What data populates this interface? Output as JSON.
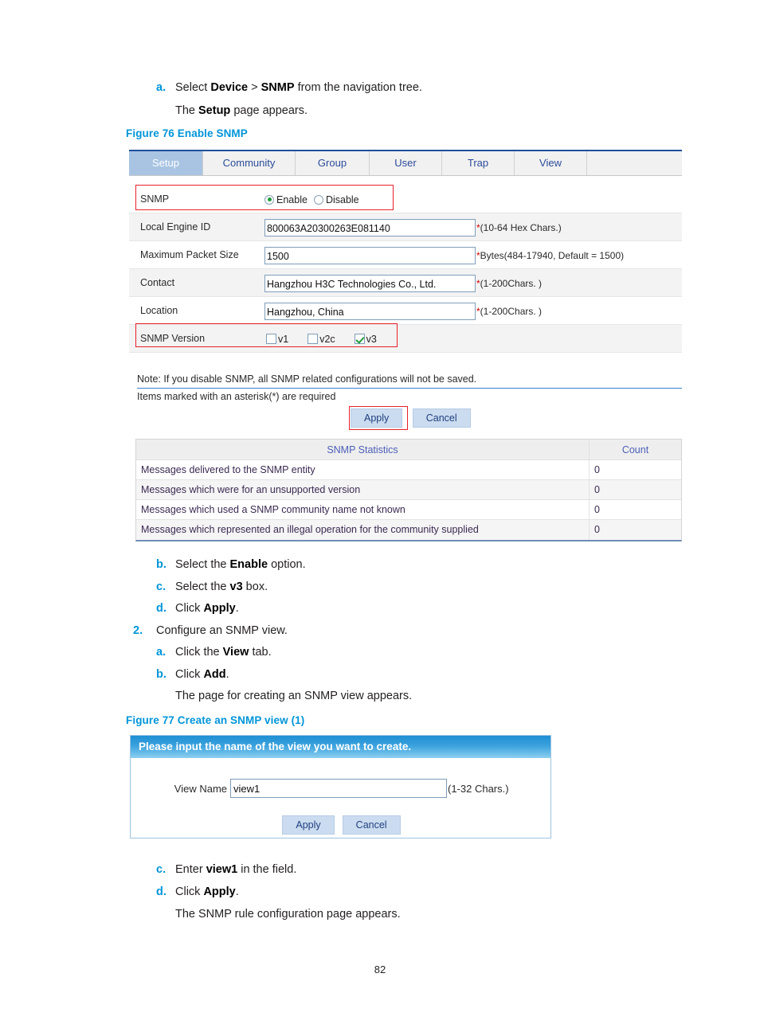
{
  "steps_top": [
    {
      "marker": "a.",
      "parts": [
        {
          "t": "Select ",
          "b": false
        },
        {
          "t": "Device",
          "b": true
        },
        {
          "t": " > ",
          "b": false
        },
        {
          "t": "SNMP",
          "b": true
        },
        {
          "t": " from the navigation tree.",
          "b": false
        }
      ]
    },
    {
      "marker": "",
      "parts": [
        {
          "t": "The ",
          "b": false
        },
        {
          "t": "Setup",
          "b": true
        },
        {
          "t": " page appears.",
          "b": false
        }
      ]
    }
  ],
  "figure76": {
    "caption": "Figure 76 Enable SNMP",
    "tabs": [
      {
        "label": "Setup",
        "active": true
      },
      {
        "label": "Community",
        "active": false
      },
      {
        "label": "Group",
        "active": false
      },
      {
        "label": "User",
        "active": false
      },
      {
        "label": "Trap",
        "active": false
      },
      {
        "label": "View",
        "active": false
      }
    ],
    "rows": {
      "snmp_label": "SNMP",
      "enable_label": "Enable",
      "disable_label": "Disable",
      "engine_label": "Local Engine ID",
      "engine_value": "800063A20300263E081140",
      "engine_hint": "(10-64 Hex Chars.)",
      "packet_label": "Maximum Packet Size",
      "packet_value": "1500",
      "packet_hint": "Bytes(484-17940, Default = 1500)",
      "contact_label": "Contact",
      "contact_value": "Hangzhou H3C Technologies Co., Ltd.",
      "contact_hint": "(1-200Chars. )",
      "location_label": "Location",
      "location_value": "Hangzhou, China",
      "location_hint": "(1-200Chars. )",
      "version_label": "SNMP Version",
      "v1_label": "v1",
      "v2c_label": "v2c",
      "v3_label": "v3"
    },
    "note_line1": "Note: If you disable SNMP, all SNMP related configurations will not be saved.",
    "note_line2": "Items marked with an asterisk(*) are required",
    "apply_label": "Apply",
    "cancel_label": "Cancel",
    "stats": {
      "header_desc": "SNMP Statistics",
      "header_count": "Count",
      "rows": [
        {
          "desc": "Messages delivered to the SNMP entity",
          "count": "0"
        },
        {
          "desc": "Messages which were for an unsupported version",
          "count": "0"
        },
        {
          "desc": "Messages which used a SNMP community name not known",
          "count": "0"
        },
        {
          "desc": "Messages which represented an illegal operation for the community supplied",
          "count": "0"
        }
      ]
    }
  },
  "steps_mid": [
    {
      "marker": "b.",
      "indent": 2,
      "parts": [
        {
          "t": "Select the ",
          "b": false
        },
        {
          "t": "Enable",
          "b": true
        },
        {
          "t": " option.",
          "b": false
        }
      ]
    },
    {
      "marker": "c.",
      "indent": 2,
      "parts": [
        {
          "t": "Select the ",
          "b": false
        },
        {
          "t": "v3",
          "b": true
        },
        {
          "t": " box.",
          "b": false
        }
      ]
    },
    {
      "marker": "d.",
      "indent": 2,
      "parts": [
        {
          "t": "Click ",
          "b": false
        },
        {
          "t": "Apply",
          "b": true
        },
        {
          "t": ".",
          "b": false
        }
      ]
    },
    {
      "marker": "2.",
      "indent": 1,
      "parts": [
        {
          "t": "Configure an SNMP view.",
          "b": false
        }
      ]
    },
    {
      "marker": "a.",
      "indent": 2,
      "parts": [
        {
          "t": "Click the ",
          "b": false
        },
        {
          "t": "View",
          "b": true
        },
        {
          "t": " tab.",
          "b": false
        }
      ]
    },
    {
      "marker": "b.",
      "indent": 2,
      "parts": [
        {
          "t": "Click ",
          "b": false
        },
        {
          "t": "Add",
          "b": true
        },
        {
          "t": ".",
          "b": false
        }
      ]
    },
    {
      "marker": "",
      "indent": 2,
      "parts": [
        {
          "t": "The page for creating an SNMP view appears.",
          "b": false
        }
      ]
    }
  ],
  "figure77": {
    "caption": "Figure 77 Create an SNMP view (1)",
    "header": "Please input the name of the view you want to create.",
    "view_name_label": "View Name",
    "view_name_value": "view1",
    "view_name_placeholder": "",
    "view_name_hint": "(1-32 Chars.)",
    "apply_label": "Apply",
    "cancel_label": "Cancel"
  },
  "steps_bottom": [
    {
      "marker": "c.",
      "parts": [
        {
          "t": "Enter ",
          "b": false
        },
        {
          "t": "view1",
          "b": true
        },
        {
          "t": " in the field.",
          "b": false
        }
      ]
    },
    {
      "marker": "d.",
      "parts": [
        {
          "t": "Click ",
          "b": false
        },
        {
          "t": "Apply",
          "b": true
        },
        {
          "t": ".",
          "b": false
        }
      ]
    },
    {
      "marker": "",
      "parts": [
        {
          "t": "The SNMP rule configuration page appears.",
          "b": false
        }
      ]
    }
  ],
  "page_number": "82",
  "colors": {
    "accent_blue": "#0095d9",
    "annotation_red": "#e8212b",
    "tab_active": "#a8c4e2",
    "check_green": "#1f9b3d"
  }
}
